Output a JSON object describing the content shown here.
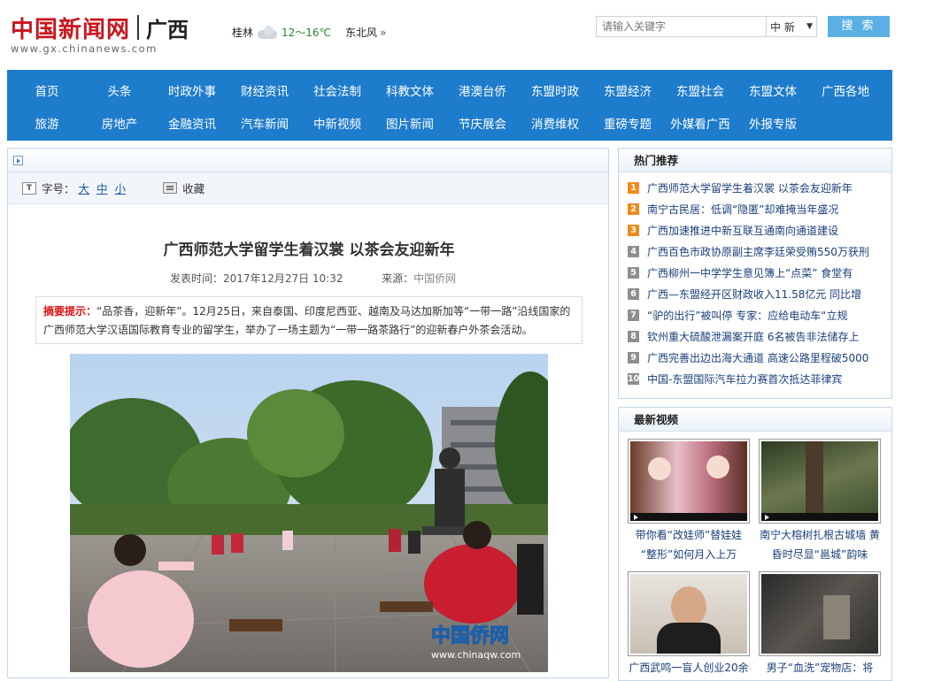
{
  "header": {
    "logo_text": "中国新闻网",
    "region": "广西",
    "site_url": "www.gx.chinanews.com",
    "weather": {
      "city": "桂林",
      "temp": "12～16℃",
      "wind": "东北风",
      "icon": "cloud-icon"
    },
    "search": {
      "placeholder": "请输入关键字",
      "scope": "中 新",
      "button": "搜 索"
    }
  },
  "nav": {
    "row1": [
      "首页",
      "头条",
      "时政外事",
      "财经资讯",
      "社会法制",
      "科教文体",
      "港澳台侨",
      "东盟时政",
      "东盟经济",
      "东盟社会",
      "东盟文体",
      "广西各地"
    ],
    "row2": [
      "旅游",
      "房地产",
      "金融资讯",
      "汽车新闻",
      "中新视频",
      "图片新闻",
      "节庆展会",
      "消费维权",
      "重磅专题",
      "外媒看广西",
      "外报专版"
    ]
  },
  "article": {
    "tools": {
      "font_label": "字号：",
      "sizes": [
        "大",
        "中",
        "小"
      ],
      "favorite": "收藏"
    },
    "title": "广西师范大学留学生着汉裳 以茶会友迎新年",
    "time_label": "发表时间：",
    "time": "2017年12月27日 10:32",
    "source_label": "来源：",
    "source": "中国侨网",
    "summary_label": "摘要提示：",
    "summary": "“品茶香，迎新年”。12月25日，来自泰国、印度尼西亚、越南及马达加斯加等“一带一路”沿线国家的广西师范大学汉语国际教育专业的留学生，举办了一场主题为“一带一路茶路行”的迎新春户外茶会活动。",
    "photo_watermark": "中国侨网",
    "photo_watermark_url": "www.chinaqw.com"
  },
  "hot": {
    "title": "热门推荐",
    "items": [
      "广西师范大学留学生着汉裳 以茶会友迎新年",
      "南宁古民居：低调“隐匿”却难掩当年盛况",
      "广西加速推进中新互联互通南向通道建设",
      "广西百色市政协原副主席李廷荣受贿550万获刑",
      "广西柳州一中学学生意见簿上“点菜” 食堂有",
      "广西—东盟经开区财政收入11.58亿元 同比增",
      "“驴的出行”被叫停 专家：应给电动车“立规",
      "钦州重大硫酸泄漏案开庭 6名被告非法储存上",
      "广西完善出边出海大通道 高速公路里程破5000",
      "中国-东盟国际汽车拉力赛首次抵达菲律宾"
    ],
    "numbers": [
      "1",
      "2",
      "3",
      "4",
      "5",
      "6",
      "7",
      "8",
      "9",
      "10"
    ]
  },
  "videos": {
    "title": "最新视频",
    "items": [
      {
        "line1": "带你看“改娃师”替娃娃",
        "line2": "“整形”如何月入上万"
      },
      {
        "line1": "南宁大榕树扎根古城墙 黄",
        "line2": "昏时尽显“邕城”韵味"
      },
      {
        "line1": "广西武鸣一盲人创业20余",
        "line2": ""
      },
      {
        "line1": "男子“血洗”宠物店：将",
        "line2": ""
      }
    ]
  }
}
